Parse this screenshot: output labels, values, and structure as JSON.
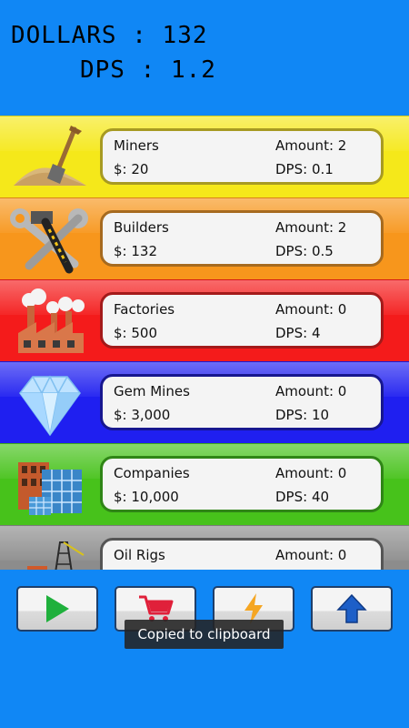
{
  "stats": {
    "dollars_label": "DOLLARS :",
    "dollars_value": "132",
    "dps_label": "DPS :",
    "dps_value": "1.2"
  },
  "rows": [
    {
      "name": "Miners",
      "cost": "$: 20",
      "amount": "Amount: 2",
      "dps": "DPS: 0.1",
      "icon": "shovel-sand-icon",
      "color": "#f5e81a",
      "border": "#a79a22"
    },
    {
      "name": "Builders",
      "cost": "$: 132",
      "amount": "Amount: 2",
      "dps": "DPS: 0.5",
      "icon": "hammer-wrench-icon",
      "color": "#f7961c",
      "border": "#a66a1f"
    },
    {
      "name": "Factories",
      "cost": "$: 500",
      "amount": "Amount: 0",
      "dps": "DPS: 4",
      "icon": "factory-icon",
      "color": "#f41b1b",
      "border": "#a31a1a"
    },
    {
      "name": "Gem Mines",
      "cost": "$: 3,000",
      "amount": "Amount: 0",
      "dps": "DPS: 10",
      "icon": "diamond-icon",
      "color": "#1f1ff0",
      "border": "#17178f"
    },
    {
      "name": "Companies",
      "cost": "$: 10,000",
      "amount": "Amount: 0",
      "dps": "DPS: 40",
      "icon": "buildings-icon",
      "color": "#47c21b",
      "border": "#2f8516"
    },
    {
      "name": "Oil Rigs",
      "cost": "",
      "amount": "Amount: 0",
      "dps": "",
      "icon": "oil-rig-icon",
      "color": "#8c8c8c",
      "border": "#555555"
    }
  ],
  "buttons": [
    {
      "icon": "play-icon",
      "color": "#1fb03c"
    },
    {
      "icon": "shopping-cart-icon",
      "color": "#e0203a"
    },
    {
      "icon": "lightning-icon",
      "color": "#f5a623"
    },
    {
      "icon": "up-arrow-icon",
      "color": "#1d5fc8"
    }
  ],
  "toast": "Copied to clipboard"
}
